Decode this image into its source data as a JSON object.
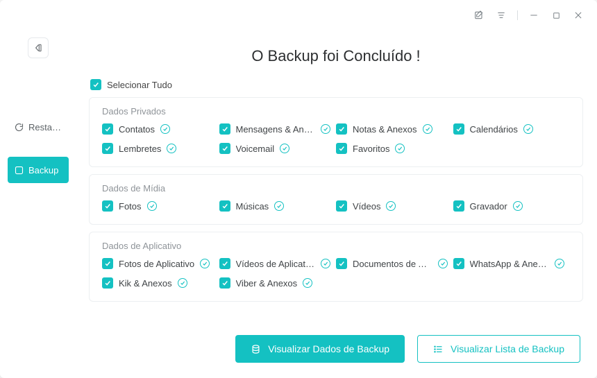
{
  "titlebar": {
    "edit_tooltip": "Feedback",
    "menu_tooltip": "Menu",
    "min_tooltip": "Minimizar",
    "max_tooltip": "Maximizar",
    "close_tooltip": "Fechar"
  },
  "sidebar": {
    "back_tooltip": "Voltar",
    "restore_label": "Restau...",
    "backup_label": "Backup"
  },
  "page_title": "O Backup foi Concluído !",
  "select_all_label": "Selecionar Tudo",
  "groups": [
    {
      "title": "Dados Privados",
      "items": [
        "Contatos",
        "Mensagens & Anexos",
        "Notas & Anexos",
        "Calendários",
        "Lembretes",
        "Voicemail",
        "Favoritos"
      ]
    },
    {
      "title": "Dados de Mídia",
      "items": [
        "Fotos",
        "Músicas",
        "Vídeos",
        "Gravador"
      ]
    },
    {
      "title": "Dados de Aplicativo",
      "items": [
        "Fotos de Aplicativo",
        "Vídeos de Aplicativo",
        "Documentos de Apli...",
        "WhatsApp & Anexos",
        "Kik & Anexos",
        "Viber & Anexos"
      ]
    }
  ],
  "buttons": {
    "view_data": "Visualizar Dados de Backup",
    "view_list": "Visualizar Lista de Backup"
  }
}
